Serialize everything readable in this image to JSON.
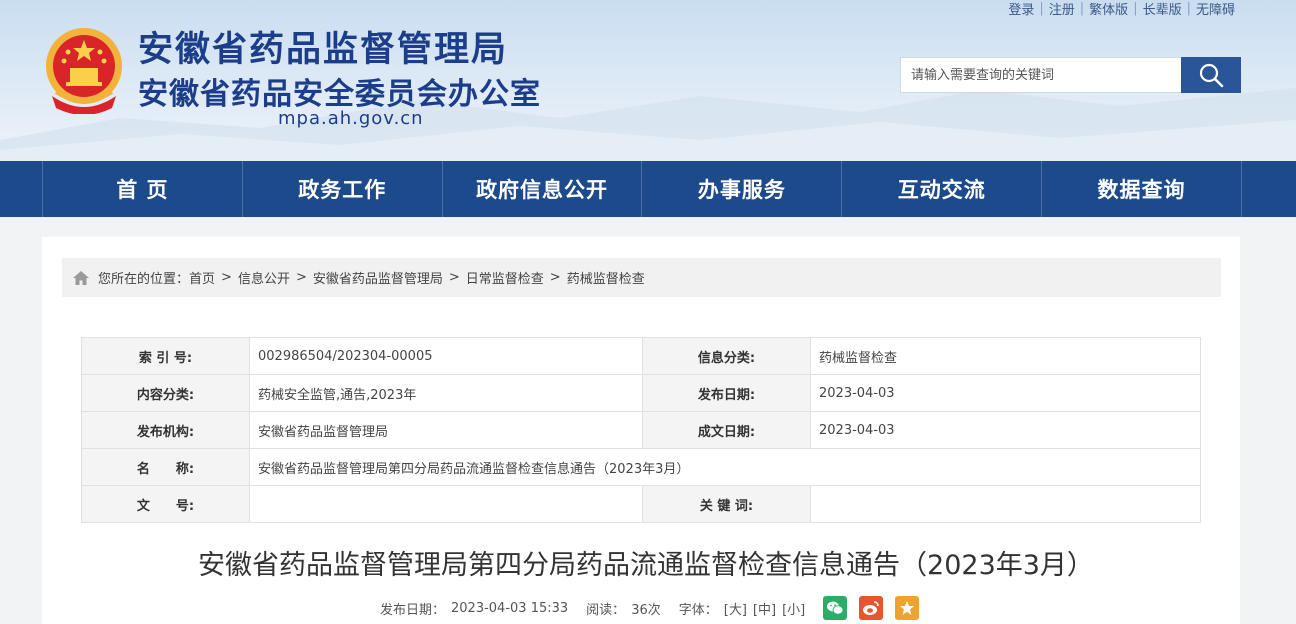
{
  "topbar": {
    "links": [
      "登录",
      "注册",
      "繁体版",
      "长辈版",
      "无障碍"
    ]
  },
  "site": {
    "title1": "安徽省药品监督管理局",
    "title2": "安徽省药品安全委员会办公室",
    "domain": "mpa.ah.gov.cn"
  },
  "search": {
    "placeholder": "请输入需要查询的关键词"
  },
  "nav": {
    "items": [
      "首 页",
      "政务工作",
      "政府信息公开",
      "办事服务",
      "互动交流",
      "数据查询"
    ]
  },
  "breadcrumb": {
    "prefix": "您所在的位置：",
    "items": [
      "首页",
      "信息公开",
      "安徽省药品监督管理局",
      "日常监督检查",
      "药械监督检查"
    ],
    "separator": ">"
  },
  "info": {
    "index_label": "索 引 号:",
    "index_value": "002986504/202304-00005",
    "category_label": "信息分类:",
    "category_value": "药械监督检查",
    "content_label": "内容分类:",
    "content_value": "药械安全监管,通告,2023年",
    "publish_date_label": "发布日期:",
    "publish_date_value": "2023-04-03",
    "org_label": "发布机构:",
    "org_value": "安徽省药品监督管理局",
    "written_date_label": "成文日期:",
    "written_date_value": "2023-04-03",
    "name_label": "名　　称:",
    "name_value": "安徽省药品监督管理局第四分局药品流通监督检查信息通告（2023年3月）",
    "doc_no_label": "文　　号:",
    "doc_no_value": "",
    "keywords_label": "关 键 词:",
    "keywords_value": ""
  },
  "article": {
    "title": "安徽省药品监督管理局第四分局药品流通监督检查信息通告（2023年3月）",
    "publish_label": "发布日期：",
    "publish_time": "2023-04-03 15:33",
    "reads_label": "阅读：",
    "reads_value": "36次",
    "font_label": "字体：",
    "font_large": "[大]",
    "font_medium": "[中]",
    "font_small": "[小]"
  },
  "colors": {
    "nav_bg": "#1d4a8a",
    "title_blue": "#1c3e8a",
    "wechat": "#2aae67",
    "weibo": "#e6552e",
    "favorite": "#f0a22e"
  },
  "icons": [
    "national-emblem-icon",
    "search-icon",
    "home-icon",
    "wechat-icon",
    "weibo-icon",
    "star-icon"
  ]
}
